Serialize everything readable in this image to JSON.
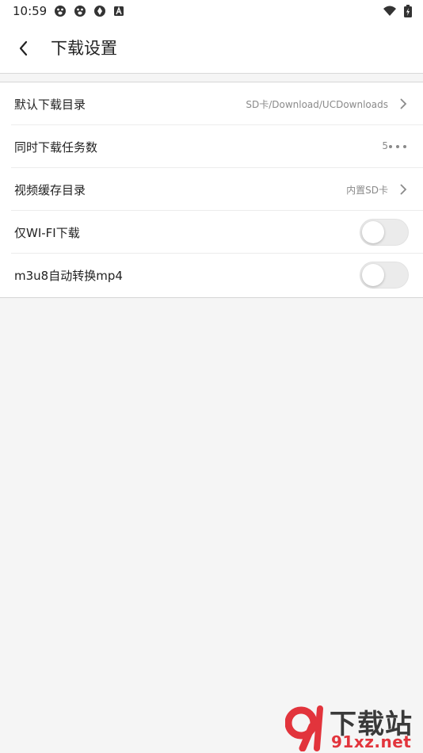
{
  "status_bar": {
    "time": "10:59",
    "left_icons": [
      "baidu-paw-icon",
      "baidu-paw-icon",
      "aperture-icon",
      "text-a-icon"
    ],
    "right_icons": [
      "wifi-icon",
      "battery-charging-icon"
    ]
  },
  "header": {
    "title": "下载设置",
    "back_icon": "chevron-left-icon"
  },
  "settings": {
    "default_dir": {
      "label": "默认下载目录",
      "value": "SD卡/Download/UCDownloads"
    },
    "concurrent": {
      "label": "同时下载任务数",
      "value": "5"
    },
    "video_cache": {
      "label": "视频缓存目录",
      "value": "内置SD卡"
    },
    "wifi_only": {
      "label": "仅WI-FI下载",
      "enabled": false
    },
    "m3u8_convert": {
      "label": "m3u8自动转换mp4",
      "enabled": false
    }
  },
  "watermark": {
    "logo": "91-logo",
    "text": "下载站",
    "url": "91xz.net"
  },
  "colors": {
    "background": "#f5f5f5",
    "card": "#ffffff",
    "secondary_text": "#8a8a8a",
    "watermark_red": "#e2343c"
  }
}
